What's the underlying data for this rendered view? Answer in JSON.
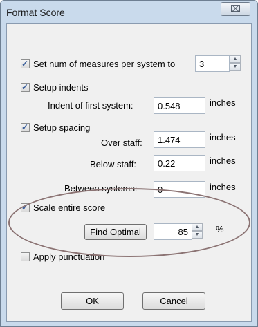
{
  "window": {
    "title": "Format Score",
    "close_label": "⌧"
  },
  "measures": {
    "label": "Set num of measures per system to",
    "value": "3",
    "checked": true
  },
  "indents": {
    "label": "Setup indents",
    "first_label": "Indent of first system:",
    "first_value": "0.548",
    "unit": "inches",
    "checked": true
  },
  "spacing": {
    "label": "Setup spacing",
    "checked": true,
    "over_label": "Over staff:",
    "over_value": "1.474",
    "below_label": "Below staff:",
    "below_value": "0.22",
    "between_label": "Between systems:",
    "between_value": "0",
    "unit": "inches"
  },
  "scale": {
    "label": "Scale entire score",
    "checked": true,
    "find_optimal_label": "Find Optimal",
    "value": "85",
    "unit": "%"
  },
  "punctuation": {
    "label": "Apply punctuation",
    "checked": false
  },
  "buttons": {
    "ok": "OK",
    "cancel": "Cancel"
  }
}
